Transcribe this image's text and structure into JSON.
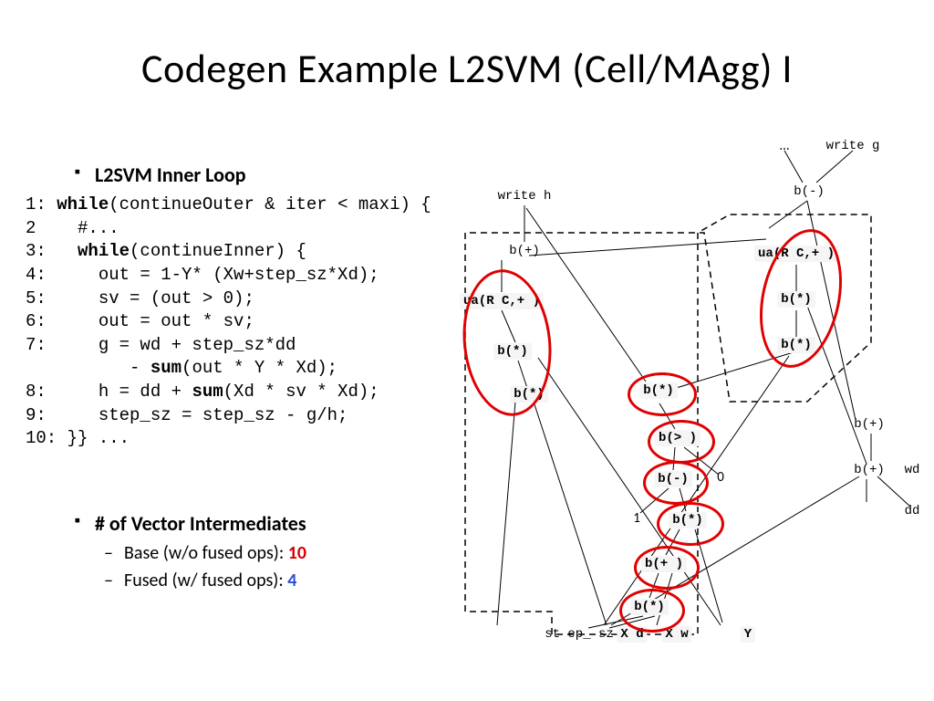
{
  "title": "Codegen Example L2SVM (Cell/MAgg) I",
  "bullet_loop": "L2SVM Inner Loop",
  "code": {
    "l1a": "1: ",
    "l1kw": "while",
    "l1b": "(continueOuter & iter < maxi) {",
    "l2": "2    #...",
    "l3a": "3:   ",
    "l3kw": "while",
    "l3b": "(continueInner) {",
    "l4": "4:     out = 1-Y* (Xw+step_sz*Xd);",
    "l5": "5:     sv = (out > 0);",
    "l6": "6:     out = out * sv;",
    "l7a": "7:     g = wd + step_sz*dd",
    "l7b": "          - ",
    "l7kw": "sum",
    "l7c": "(out * Y * Xd);",
    "l8a": "8:     h = dd + ",
    "l8kw": "sum",
    "l8b": "(Xd * sv * Xd);",
    "l9": "9:     step_sz = step_sz - g/h;",
    "l10": "10: }} ..."
  },
  "bullet_vec": "# of Vector Intermediates",
  "sub_base_a": "Base (w/o fused ops): ",
  "sub_base_b": "10",
  "sub_fused_a": "Fused (w/ fused ops):   ",
  "sub_fused_b": "4",
  "nodes": {
    "writeh": "write h",
    "writeg": "write g",
    "ellipsis": "…",
    "bminus_top": "b(-)",
    "bplus_tl": "b(+)",
    "ua_l": "ua(R C,+ )",
    "ua_r": "ua(R C,+ )",
    "bst_l": "b(*)",
    "bst_l2": "b(*)",
    "bst_r1": "b(*)",
    "bst_r2": "b(*)",
    "bst_mid": "b(*)",
    "bgt": "b(> )",
    "bminus": "b(-)",
    "zero": "0",
    "one": "1",
    "bst_mid2": "b(*)",
    "bplus_mid": "b(+ )",
    "bst_bot": "b(*)",
    "bplus_r1": "b(+)",
    "bplus_r2": "b(+)",
    "wd": "wd",
    "dd": "dd",
    "stepsz": "st ep_ sz",
    "xd": "X d",
    "xw": "X w",
    "y": "Y"
  }
}
